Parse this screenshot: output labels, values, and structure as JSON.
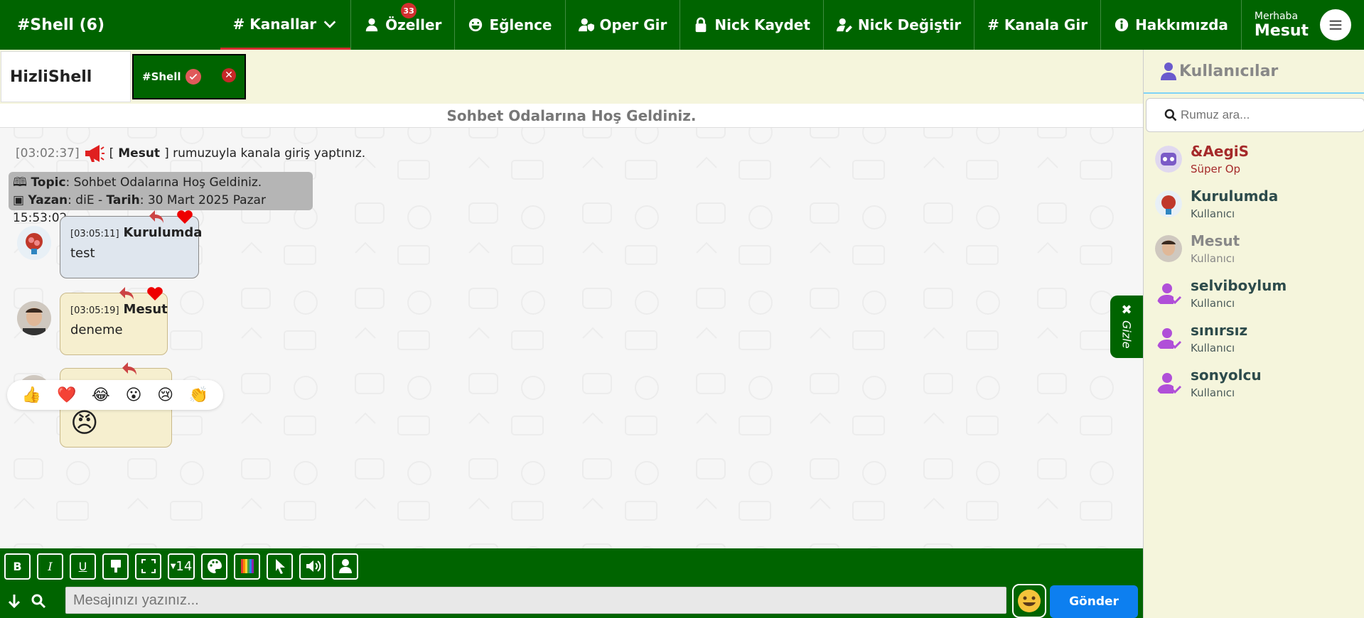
{
  "brand": "#Shell (6)",
  "nav": {
    "items": [
      {
        "label": "# Kanallar",
        "icon": "chevron-down-icon"
      },
      {
        "label": "Özeller",
        "badge": "33",
        "icon": "user-icon"
      },
      {
        "label": "Eğlence",
        "icon": "laugh-icon"
      },
      {
        "label": "Oper Gir",
        "icon": "user-shield-icon"
      },
      {
        "label": "Nick Kaydet",
        "icon": "lock-icon"
      },
      {
        "label": "Nick Değiştir",
        "icon": "user-pen-icon"
      },
      {
        "label": "# Kanala Gir",
        "icon": "hash-icon"
      },
      {
        "label": "Hakkımızda",
        "icon": "info-icon"
      }
    ],
    "greeting": "Merhaba",
    "username": "Mesut"
  },
  "tabs": {
    "main": "HizliShell",
    "channel": "#Shell"
  },
  "chat": {
    "welcome": "Sohbet Odalarına Hoş Geldiniz.",
    "system": {
      "ts": "[03:02:37]",
      "open": "[",
      "nick": "Mesut",
      "text": "] rumuzuyla kanala giriş yaptınız."
    },
    "topic": {
      "label": "Topic",
      "value": ": Sohbet Odalarına Hoş Geldiniz.",
      "author_label": "Yazan",
      "author": ": diE - ",
      "date_label": "Tarih",
      "date": ": 30 Mart 2025 Pazar 15:53:02"
    },
    "messages": [
      {
        "ts": "[03:05:11]",
        "nick": "Kurulumda",
        "text": "test"
      },
      {
        "ts": "[03:05:19]",
        "nick": "Mesut",
        "text": "deneme"
      },
      {
        "text": "😠"
      }
    ],
    "reactions": [
      "👍",
      "❤️",
      "😂",
      "😮",
      "😢",
      "👏"
    ]
  },
  "gizle": {
    "x": "✖",
    "label": "Gizle"
  },
  "toolbar": {
    "bold": "B",
    "italic": "I",
    "underline": "U",
    "size": "14"
  },
  "input": {
    "placeholder": "Mesajınızı yazınız...",
    "send": "Gönder"
  },
  "users": {
    "title": "Kullanıcılar",
    "search_placeholder": "Rumuz ara...",
    "list": [
      {
        "nick": "&AegiS",
        "role": "Süper Op",
        "color": "#a52a2a"
      },
      {
        "nick": "Kurulumda",
        "role": "Kullanıcı",
        "color": "#2d4b4b"
      },
      {
        "nick": "Mesut",
        "role": "Kullanıcı",
        "color": "#888888"
      },
      {
        "nick": "selviboylum",
        "role": "Kullanıcı",
        "color": "#2d4b4b"
      },
      {
        "nick": "sınırsız",
        "role": "Kullanıcı",
        "color": "#2d4b4b"
      },
      {
        "nick": "sonyolcu",
        "role": "Kullanıcı",
        "color": "#2d4b4b"
      }
    ]
  },
  "colors": {
    "primary": "#006400",
    "accent": "#d32f2f",
    "send": "#0d7ff0",
    "panel": "#f5f5dc"
  }
}
